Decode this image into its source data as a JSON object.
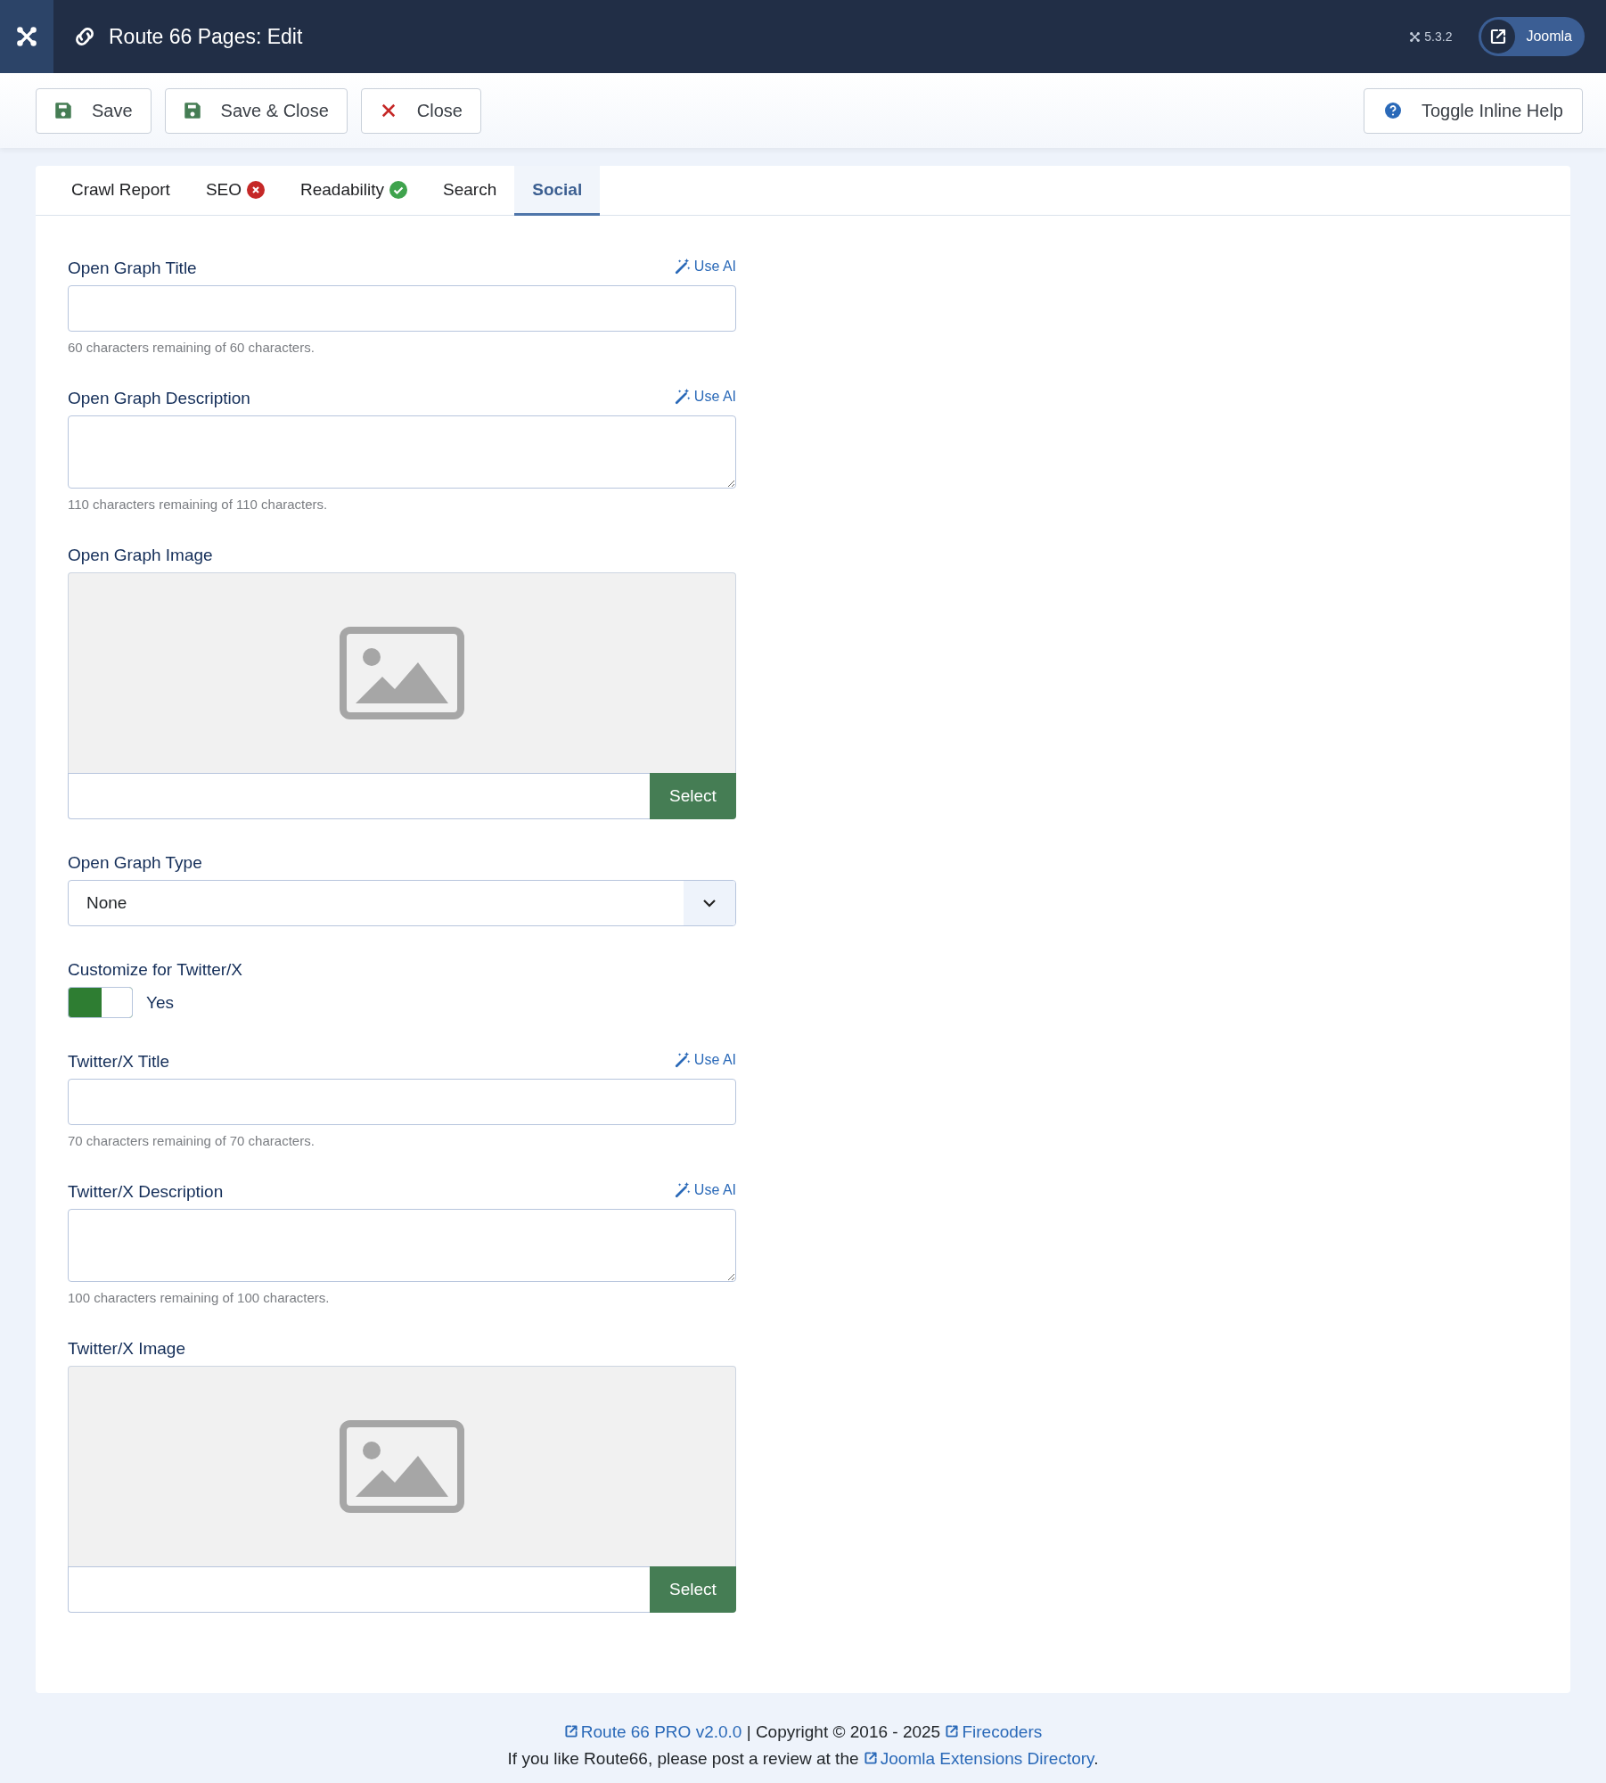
{
  "header": {
    "title": "Route 66 Pages: Edit",
    "version": "5.3.2",
    "site_button": "Joomla"
  },
  "toolbar": {
    "buttons": [
      {
        "label": "Save",
        "kind": "save"
      },
      {
        "label": "Save & Close",
        "kind": "save"
      },
      {
        "label": "Close",
        "kind": "close"
      }
    ],
    "help_button": "Toggle Inline Help"
  },
  "tabs": [
    {
      "label": "Crawl Report",
      "selected": false,
      "kind": "plain"
    },
    {
      "label": "SEO",
      "selected": false,
      "kind": "error"
    },
    {
      "label": "Readability",
      "selected": false,
      "kind": "ok"
    },
    {
      "label": "Search",
      "selected": false,
      "kind": "plain"
    },
    {
      "label": "Social",
      "selected": true,
      "kind": "plain"
    }
  ],
  "fields": [
    {
      "kind": "text",
      "label": "Open Graph Title",
      "ai_link": "Use AI",
      "hint": "60 characters remaining of 60 characters."
    },
    {
      "kind": "textarea",
      "label": "Open Graph Description",
      "ai_link": "Use AI",
      "hint": "110 characters remaining of 110 characters."
    },
    {
      "kind": "image",
      "label": "Open Graph Image",
      "button": "Select"
    },
    {
      "kind": "select",
      "label": "Open Graph Type",
      "value": "None"
    },
    {
      "kind": "toggle",
      "label": "Customize for Twitter/X",
      "on": true,
      "value": "Yes"
    },
    {
      "kind": "text",
      "label": "Twitter/X Title",
      "ai_link": "Use AI",
      "hint": "70 characters remaining of 70 characters."
    },
    {
      "kind": "textarea",
      "label": "Twitter/X Description",
      "ai_link": "Use AI",
      "hint": "100 characters remaining of 100 characters."
    },
    {
      "kind": "image",
      "label": "Twitter/X Image",
      "button": "Select"
    }
  ],
  "footer": [
    [
      {
        "kind": "link",
        "text": "Route 66 PRO v2.0.0"
      },
      {
        "kind": "text",
        "text": " | Copyright © 2016 - 2025 "
      },
      {
        "kind": "link",
        "text": "Firecoders"
      }
    ],
    [
      {
        "kind": "text",
        "text": "If you like Route66, please post a review at the "
      },
      {
        "kind": "link",
        "text": "Joomla Extensions Directory"
      },
      {
        "kind": "text",
        "text": "."
      }
    ]
  ]
}
